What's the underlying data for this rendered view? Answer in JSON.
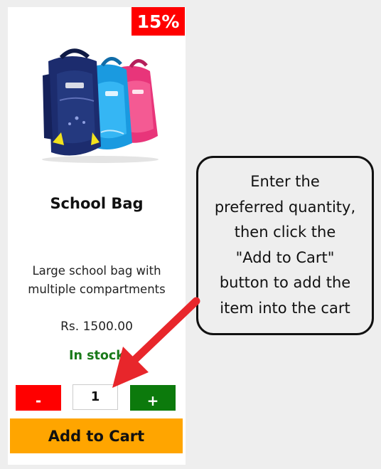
{
  "product": {
    "discount_badge": "15%",
    "image_icon": "school-backpack-image",
    "name": "School Bag",
    "description_line1": "Large school bag with",
    "description_line2": "multiple compartments",
    "price": "Rs. 1500.00",
    "stock_status": "In stock",
    "quantity": "1",
    "decrement_label": "-",
    "increment_label": "+",
    "add_to_cart_label": "Add to Cart"
  },
  "tooltip": {
    "text": "Enter the\npreferred quantity,\nthen click the\n\"Add to Cart\"\nbutton to add the\nitem into the cart"
  },
  "colors": {
    "discount_badge": "#ff0000",
    "stock_status": "#1a7a1a",
    "decrement_button": "#ff0000",
    "increment_button": "#0c7a0c",
    "add_to_cart_button": "#ffa500",
    "arrow": "#e8262b"
  }
}
